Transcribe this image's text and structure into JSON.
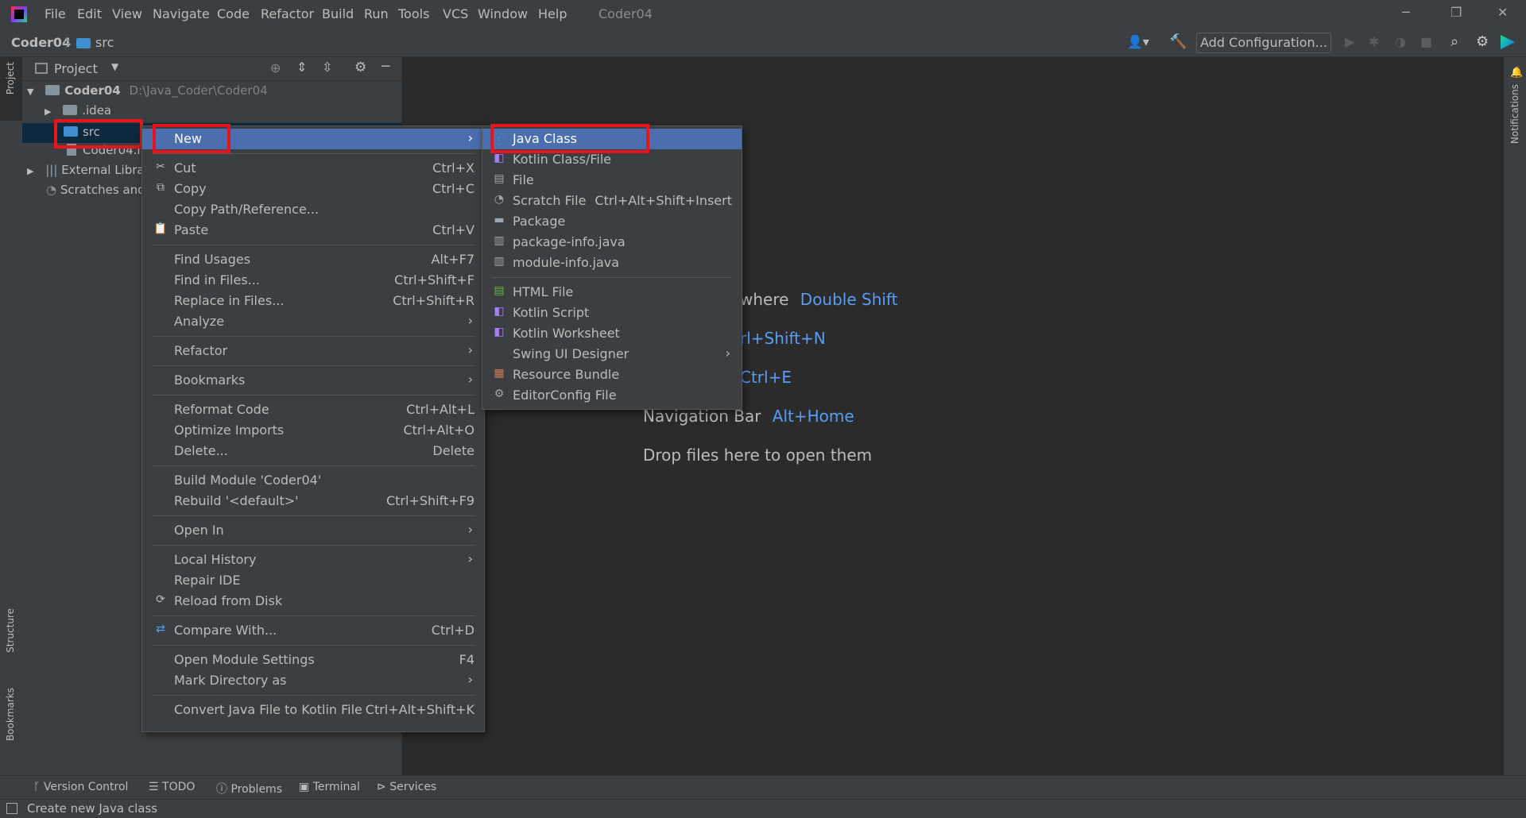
{
  "menubar": [
    "File",
    "Edit",
    "View",
    "Navigate",
    "Code",
    "Refactor",
    "Build",
    "Run",
    "Tools",
    "VCS",
    "Window",
    "Help"
  ],
  "window_title": "Coder04",
  "breadcrumb": {
    "project": "Coder04",
    "folder": "src"
  },
  "toolbar": {
    "add_config": "Add Configuration..."
  },
  "left_stripe": {
    "project": "Project",
    "structure": "Structure",
    "bookmarks": "Bookmarks"
  },
  "right_stripe": {
    "notifications": "Notifications"
  },
  "project_panel": {
    "title": "Project"
  },
  "tree": {
    "root": "Coder04",
    "root_path": "D:\\Java_Coder\\Coder04",
    "idea": ".idea",
    "src": "src",
    "iml": "Coder04.i",
    "external": "External Libra",
    "scratches": "Scratches and"
  },
  "editor_hints": {
    "search_tail": "where",
    "search_key": "Double Shift",
    "goto_file_key": "rl+Shift+N",
    "recent_key": "Ctrl+E",
    "navbar_label": "Navigation Bar",
    "navbar_key": "Alt+Home",
    "drop": "Drop files here to open them"
  },
  "context_menu": {
    "new": "New",
    "cut": "Cut",
    "cut_sc": "Ctrl+X",
    "copy": "Copy",
    "copy_sc": "Ctrl+C",
    "copy_path": "Copy Path/Reference...",
    "paste": "Paste",
    "paste_sc": "Ctrl+V",
    "find_usages": "Find Usages",
    "find_usages_sc": "Alt+F7",
    "find_in_files": "Find in Files...",
    "find_in_files_sc": "Ctrl+Shift+F",
    "replace_in_files": "Replace in Files...",
    "replace_in_files_sc": "Ctrl+Shift+R",
    "analyze": "Analyze",
    "refactor": "Refactor",
    "bookmarks": "Bookmarks",
    "reformat": "Reformat Code",
    "reformat_sc": "Ctrl+Alt+L",
    "optimize": "Optimize Imports",
    "optimize_sc": "Ctrl+Alt+O",
    "delete": "Delete...",
    "delete_sc": "Delete",
    "build_module": "Build Module 'Coder04'",
    "rebuild": "Rebuild '<default>'",
    "rebuild_sc": "Ctrl+Shift+F9",
    "open_in": "Open In",
    "local_history": "Local History",
    "repair": "Repair IDE",
    "reload": "Reload from Disk",
    "compare": "Compare With...",
    "compare_sc": "Ctrl+D",
    "module_settings": "Open Module Settings",
    "module_settings_sc": "F4",
    "mark_dir": "Mark Directory as",
    "convert": "Convert Java File to Kotlin File",
    "convert_sc": "Ctrl+Alt+Shift+K"
  },
  "new_submenu": {
    "java_class": "Java Class",
    "kotlin_class": "Kotlin Class/File",
    "file": "File",
    "scratch": "Scratch File",
    "scratch_sc": "Ctrl+Alt+Shift+Insert",
    "package": "Package",
    "package_info": "package-info.java",
    "module_info": "module-info.java",
    "html": "HTML File",
    "kotlin_script": "Kotlin Script",
    "kotlin_worksheet": "Kotlin Worksheet",
    "swing": "Swing UI Designer",
    "resource_bundle": "Resource Bundle",
    "editorconfig": "EditorConfig File"
  },
  "bottom_tools": {
    "vcs": "Version Control",
    "todo": "TODO",
    "problems": "Problems",
    "terminal": "Terminal",
    "services": "Services"
  },
  "status_text": "Create new Java class",
  "colors": {
    "accent": "#4b6eaf",
    "link": "#589df6",
    "highlight_box": "#e8141c"
  }
}
